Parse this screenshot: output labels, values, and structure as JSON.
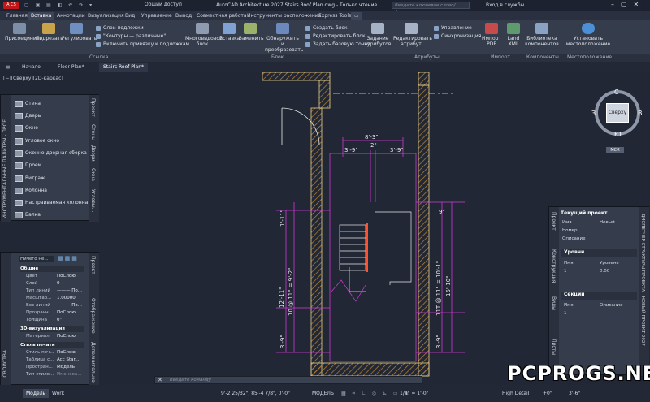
{
  "titlebar": {
    "app_badge": "A CS",
    "share": "Общий доступ",
    "title": "AutoCAD Architecture 2027   Stairs Roof Plan.dwg - Только чтение",
    "search_placeholder": "Введите ключевое слово/фразу",
    "signin": "Вход в службы"
  },
  "ribbon_tabs": [
    "Главная",
    "Вставка",
    "Аннотации",
    "Визуализация",
    "Вид",
    "Управление",
    "Вывод",
    "Совместная работа",
    "Инструменты расположения",
    "Express Tools"
  ],
  "ribbon": {
    "attach": "Присоединить",
    "clip": "Подрезать",
    "adjust": "Регулировать",
    "underlay_layers": "Слои подложки",
    "frames": "\"Контуры — различные\"",
    "snap": "Включить привязку к подложкам",
    "multiview_block": "Многовидовой блок",
    "insert": "Вставка",
    "replace": "Заменить",
    "detect": "Обнаружить и преобразовать",
    "create_block": "Создать блок",
    "edit_block": "Редактировать блок",
    "set_base": "Задать базовую точку",
    "define_attrs": "Задание атрибутов",
    "edit_attr": "Редактировать атрибут",
    "manage": "Управление",
    "sync": "Синхронизация",
    "import_pdf": "Импорт PDF",
    "land_xml": "Land XML",
    "comp_lib": "Библиотека компонентов",
    "set_location": "Установить местоположение",
    "groups": [
      "Ссылка",
      "Блок",
      "Атрибуты",
      "Импорт",
      "Компоненты",
      "Местоположение"
    ]
  },
  "doc_tabs": [
    "Начало",
    "Floor Plan*",
    "Stairs Roof Plan*"
  ],
  "viewport_label": "[−][Сверху][2D-каркас]",
  "viewcube": {
    "n": "С",
    "s": "Ю",
    "w": "З",
    "e": "В",
    "top": "Сверху",
    "wcs": "МСК"
  },
  "tool_palette": {
    "title": "ИНСТРУМЕНТАЛЬНЫЕ ПАЛИТРЫ - ПРОЕ",
    "items": [
      "Стена",
      "Дверь",
      "Окно",
      "Угловое окно",
      "Оконно-дверная сборка",
      "Проем",
      "Витраж",
      "Колонна",
      "Настраиваемая колонна",
      "Балка"
    ],
    "vtabs": [
      "Проект",
      "Стены",
      "Двери",
      "Окна",
      "Угловы..."
    ]
  },
  "properties": {
    "title": "СВОЙСТВА",
    "selection": "Ничего не...",
    "general": "Общие",
    "rows": [
      {
        "k": "Цвет",
        "v": "ПоСлою"
      },
      {
        "k": "Слой",
        "v": "0"
      },
      {
        "k": "Тип линий",
        "v": "——— По..."
      },
      {
        "k": "Масштаб...",
        "v": "1.00000"
      },
      {
        "k": "Вес линий",
        "v": "——— По..."
      },
      {
        "k": "Прозрачн...",
        "v": "ПоСлою"
      },
      {
        "k": "Толщина",
        "v": "0\""
      }
    ],
    "viz": "3D-визуализация",
    "material_k": "Материал",
    "material_v": "ПоСлою",
    "print": "Стиль печати",
    "print_rows": [
      {
        "k": "Стиль печ...",
        "v": "ПоСлою"
      },
      {
        "k": "Таблица с...",
        "v": "Acc Star..."
      },
      {
        "k": "Простран...",
        "v": "Модель"
      },
      {
        "k": "Тип стиле...",
        "v": "Именова..."
      }
    ],
    "vtabs": [
      "Проект",
      "Отображение",
      "Дополнительно"
    ]
  },
  "project_nav": {
    "title": "ДИСПЕТЧЕР СТРУКТУРЫ ПРОЕКТА - НОВЫЙ ПРОЕКТ 2027",
    "current": "Текущий проект",
    "name_k": "Имя",
    "name_v": "Новый...",
    "number_k": "Номер",
    "desc_k": "Описание",
    "levels": "Уровни",
    "col_name": "Имя",
    "col_level": "Уровень",
    "level_row_name": "1",
    "level_row_val": "0.00",
    "sections": "Секции",
    "sec_col_name": "Имя",
    "sec_col_desc": "Описание",
    "sec_row": "1",
    "vtabs": [
      "Проект",
      "Конструкция",
      "Виды",
      "Листы"
    ]
  },
  "dims": {
    "top": "8'-3\"",
    "left": "3'-9\"",
    "mid": "2\"",
    "right": "3'-9\"",
    "v1": "1'-11\"",
    "v2": "10 @ 11\" = 9'-2\"",
    "v3": "12'-11\"",
    "v4": "3'-9\"",
    "v5": "11T @ 11\" = 10'-1\"",
    "v6": "15'-10\"",
    "v7": "3'-9\"",
    "v8": "9\""
  },
  "command_placeholder": "Введите команду",
  "status": {
    "model_tab": "Модель",
    "work_tab": "Work",
    "coords": "9'-2 25/32\", 85'-4 7/8\", 0'-0\"",
    "mode": "МОДЕЛЬ",
    "scale": "1/4\" = 1'-0\"",
    "detail": "High Detail",
    "elev": "+0\"",
    "cut": "3'-6\""
  },
  "watermark": "PCPROGS.NET",
  "colors": {
    "accent": "#4a6fb5",
    "magenta": "#d23ad8",
    "wall": "#e8d08a",
    "hatch": "#b8863a",
    "stair": "#ff5030"
  }
}
